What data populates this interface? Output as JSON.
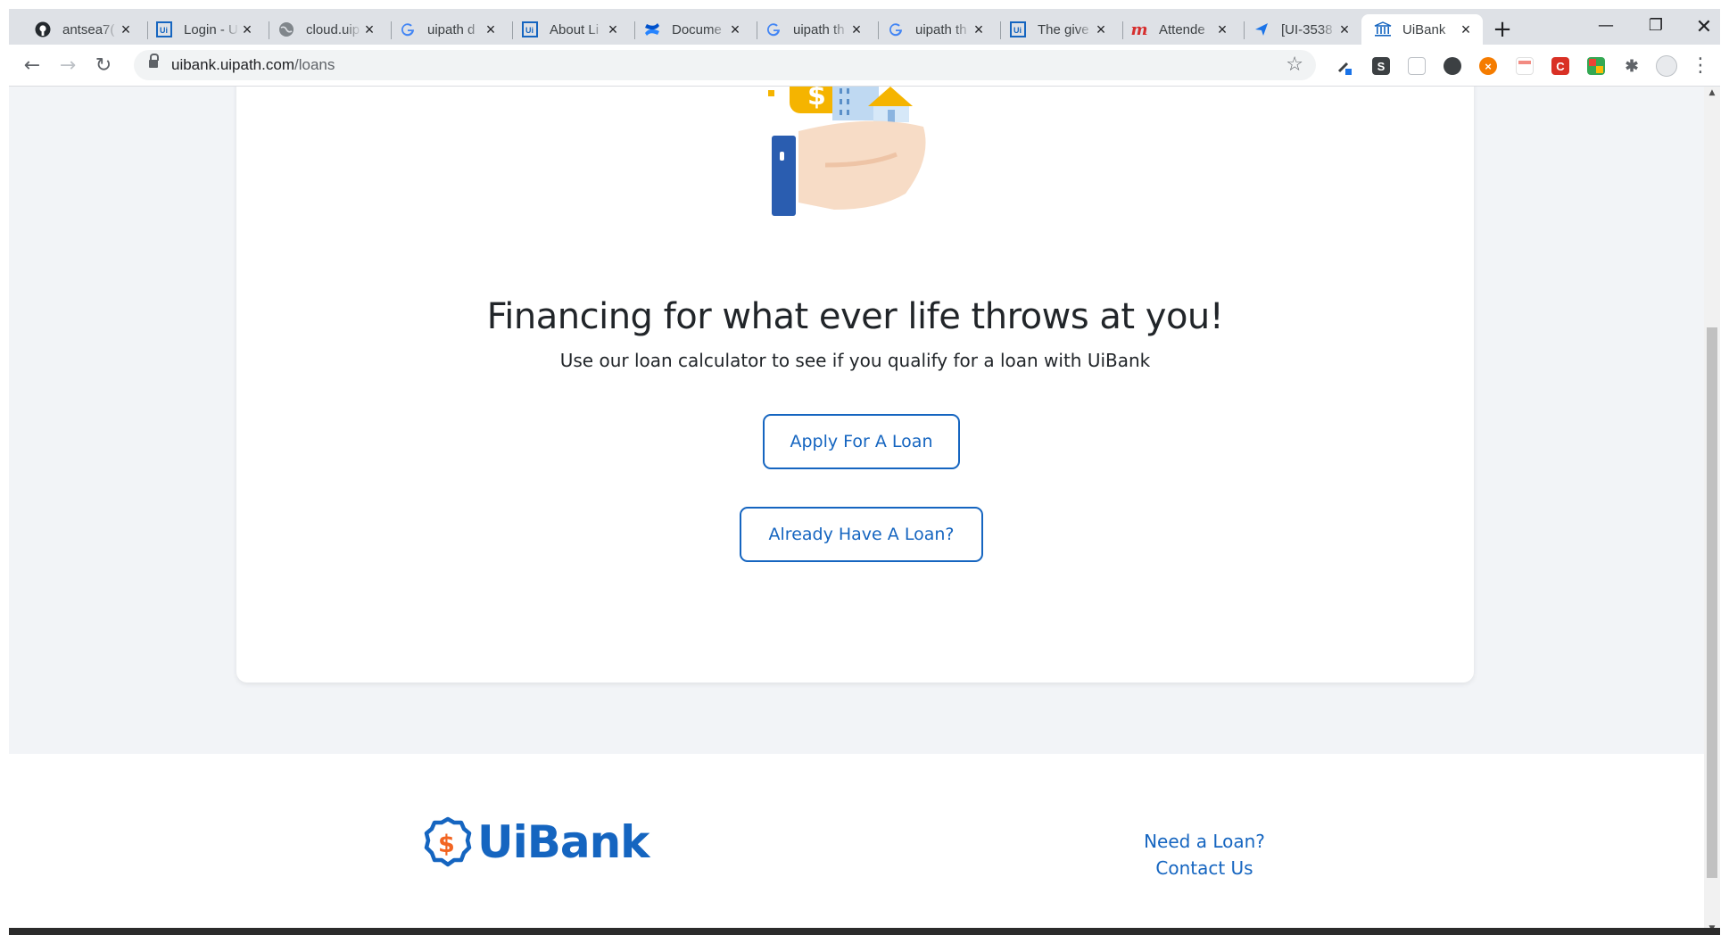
{
  "browser": {
    "tabs": [
      {
        "label": "antsea7(",
        "favicon": "github-icon",
        "active": false
      },
      {
        "label": "Login - U",
        "favicon": "uipath-icon",
        "active": false
      },
      {
        "label": "cloud.uip",
        "favicon": "globe-icon",
        "active": false
      },
      {
        "label": "uipath d",
        "favicon": "google-icon",
        "active": false
      },
      {
        "label": "About Li",
        "favicon": "uipath-icon",
        "active": false
      },
      {
        "label": "Docume",
        "favicon": "confluence-icon",
        "active": false
      },
      {
        "label": "uipath th",
        "favicon": "google-icon",
        "active": false
      },
      {
        "label": "uipath th",
        "favicon": "google-icon",
        "active": false
      },
      {
        "label": "The give",
        "favicon": "uipath-icon",
        "active": false
      },
      {
        "label": "Attende",
        "favicon": "m-icon",
        "active": false
      },
      {
        "label": "[UI-3538",
        "favicon": "jira-icon",
        "active": false
      },
      {
        "label": "UiBank",
        "favicon": "bank-icon",
        "active": true
      }
    ],
    "url_host": "uibank.uipath.com",
    "url_path": "/loans",
    "colors": {
      "tabstrip": "#dee1e6",
      "omnibox": "#f1f3f4"
    }
  },
  "page": {
    "title": "Financing for what ever life throws at you!",
    "subtitle": "Use our loan calculator to see if you qualify for a loan with UiBank",
    "apply_button": "Apply For A Loan",
    "existing_button": "Already Have A Loan?",
    "colors": {
      "accent": "#1565c0",
      "background": "#f2f4f7"
    }
  },
  "footer": {
    "brand": "UiBank",
    "links": [
      "Need a Loan?",
      "Contact Us"
    ]
  }
}
